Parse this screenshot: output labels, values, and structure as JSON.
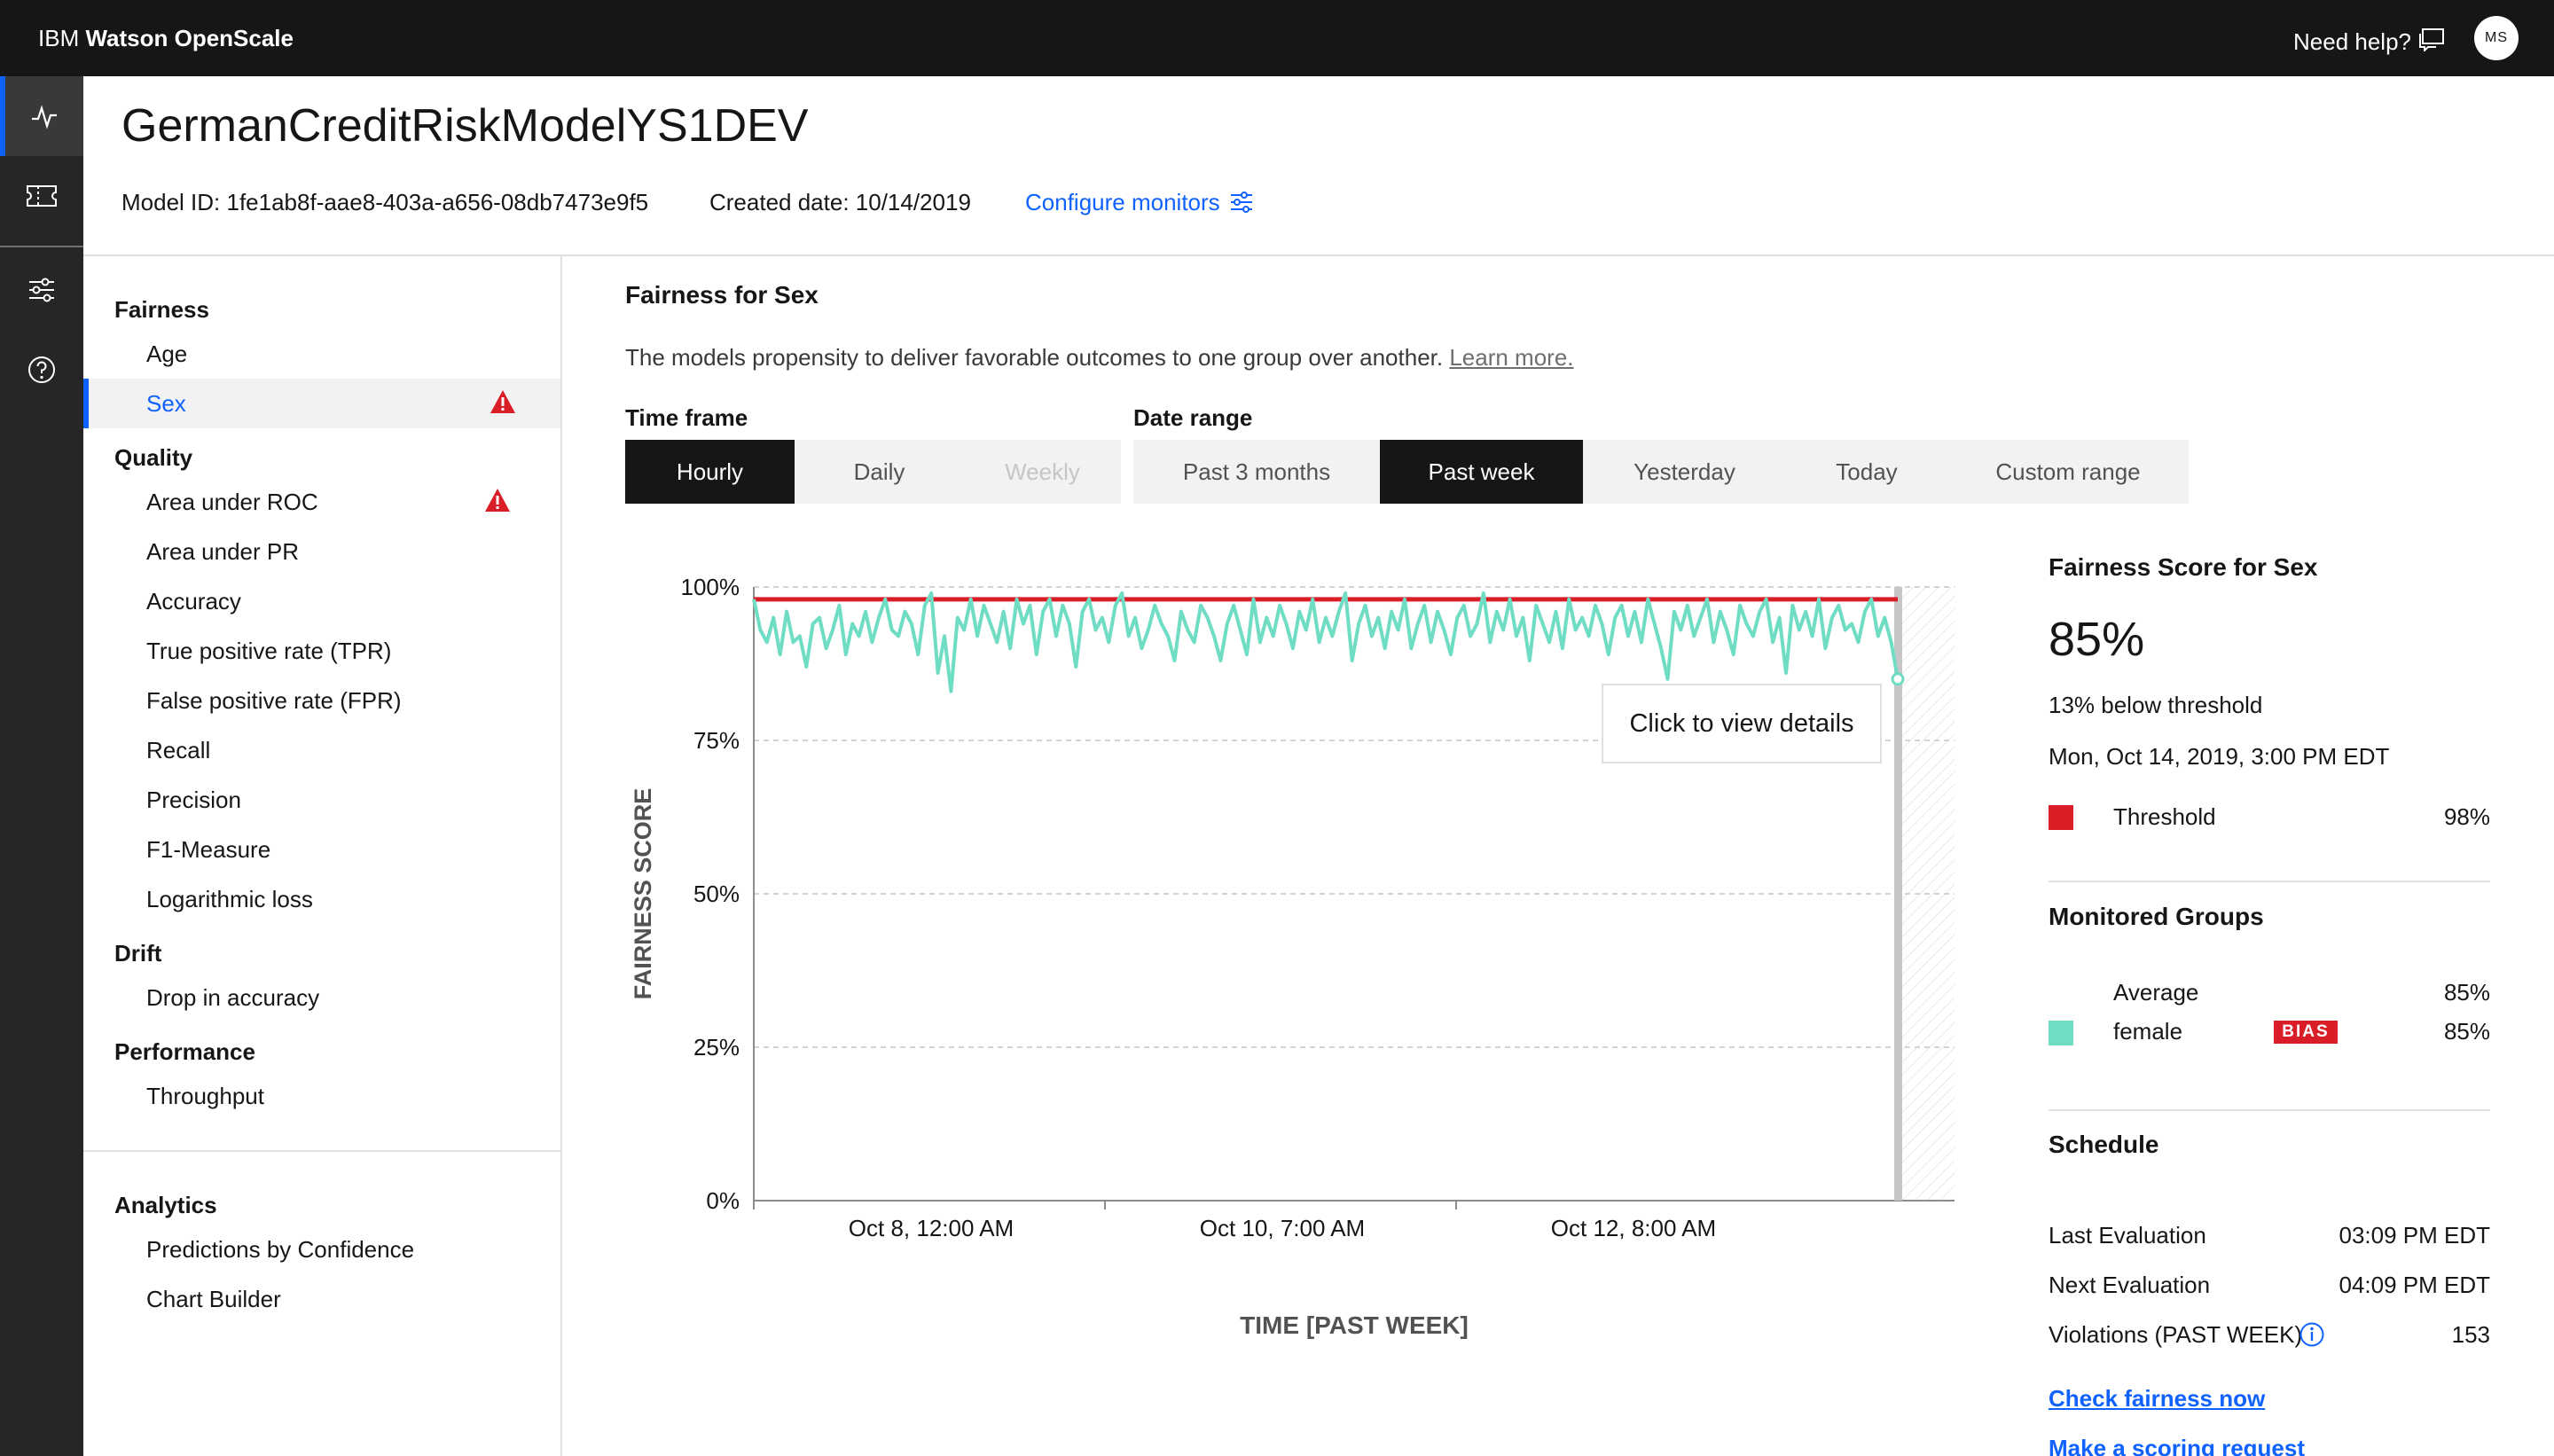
{
  "app": {
    "brand_prefix": "IBM ",
    "brand_name": "Watson OpenScale",
    "help_label": "Need help?",
    "user_initials": "MS"
  },
  "model": {
    "title": "GermanCreditRiskModelYS1DEV",
    "model_id": "Model ID: 1fe1ab8f-aae8-403a-a656-08db7473e9f5",
    "created": "Created date: 10/14/2019",
    "configure_label": "Configure monitors"
  },
  "nav": {
    "fairness": {
      "heading": "Fairness",
      "items": [
        "Age",
        "Sex"
      ]
    },
    "quality": {
      "heading": "Quality",
      "items": [
        "Area under ROC",
        "Area under PR",
        "Accuracy",
        "True positive rate (TPR)",
        "False positive rate (FPR)",
        "Recall",
        "Precision",
        "F1-Measure",
        "Logarithmic loss"
      ]
    },
    "drift": {
      "heading": "Drift",
      "items": [
        "Drop in accuracy"
      ]
    },
    "performance": {
      "heading": "Performance",
      "items": [
        "Throughput"
      ]
    },
    "analytics": {
      "heading": "Analytics",
      "items": [
        "Predictions by Confidence",
        "Chart Builder"
      ]
    },
    "selected": "Sex"
  },
  "main": {
    "section_title": "Fairness for Sex",
    "description": "The models propensity to deliver favorable outcomes to one group over another. ",
    "learn_more": "Learn more.",
    "timeframe_label": "Time frame",
    "timeframe_options": [
      "Hourly",
      "Daily",
      "Weekly"
    ],
    "timeframe_selected": "Hourly",
    "daterange_label": "Date range",
    "daterange_options": [
      "Past 3 months",
      "Past week",
      "Yesterday",
      "Today",
      "Custom range"
    ],
    "daterange_selected": "Past week",
    "tooltip": "Click to view details"
  },
  "chart_data": {
    "type": "line",
    "ylabel": "FAIRNESS SCORE",
    "xlabel": "TIME [PAST WEEK]",
    "ylim": [
      0,
      100
    ],
    "yticks": [
      "0%",
      "25%",
      "50%",
      "75%",
      "100%"
    ],
    "xticks": [
      "Oct 8, 12:00 AM",
      "Oct 10, 7:00 AM",
      "Oct 12, 8:00 AM"
    ],
    "threshold": 98,
    "threshold_color": "#da1e28",
    "series": [
      {
        "name": "female",
        "color": "#6fdcc4",
        "values": [
          98,
          93,
          91,
          95,
          89,
          96,
          91,
          92,
          87,
          94,
          95,
          90,
          93,
          97,
          89,
          94,
          92,
          96,
          91,
          95,
          98,
          93,
          92,
          96,
          94,
          89,
          97,
          99,
          86,
          92,
          83,
          95,
          93,
          98,
          92,
          97,
          94,
          91,
          96,
          90,
          98,
          94,
          97,
          89,
          96,
          98,
          92,
          97,
          94,
          87,
          96,
          98,
          93,
          95,
          91,
          97,
          99,
          92,
          95,
          90,
          93,
          97,
          94,
          92,
          88,
          96,
          93,
          91,
          97,
          95,
          92,
          88,
          94,
          97,
          93,
          89,
          98,
          91,
          95,
          92,
          97,
          94,
          90,
          96,
          93,
          98,
          91,
          95,
          92,
          96,
          99,
          88,
          94,
          97,
          92,
          95,
          90,
          96,
          93,
          98,
          90,
          94,
          97,
          91,
          96,
          93,
          89,
          95,
          97,
          92,
          94,
          99,
          91,
          96,
          93,
          98,
          92,
          95,
          88,
          97,
          94,
          91,
          96,
          90,
          98,
          93,
          95,
          92,
          97,
          94,
          89,
          95,
          97,
          92,
          96,
          91,
          98,
          94,
          90,
          85,
          96,
          93,
          97,
          92,
          95,
          98,
          91,
          96,
          93,
          89,
          97,
          94,
          92,
          96,
          98,
          91,
          95,
          86,
          97,
          93,
          96,
          92,
          98,
          90,
          95,
          97,
          93,
          94,
          91,
          96,
          98,
          92,
          95,
          91,
          85
        ]
      }
    ]
  },
  "panel": {
    "score_title": "Fairness Score for Sex",
    "score": "85%",
    "below": "13% below threshold",
    "timestamp": "Mon, Oct 14, 2019, 3:00 PM EDT",
    "threshold_label": "Threshold",
    "threshold_value": "98%",
    "groups_title": "Monitored Groups",
    "avg_label": "Average",
    "avg_value": "85%",
    "female_label": "female",
    "female_badge": "BIAS",
    "female_value": "85%",
    "schedule_title": "Schedule",
    "last_label": "Last Evaluation",
    "last_value": "03:09 PM EDT",
    "next_label": "Next Evaluation",
    "next_value": "04:09 PM EDT",
    "violations_label": "Violations (PAST WEEK)",
    "violations_value": "153",
    "check_link": "Check fairness now",
    "scoring_link": "Make a scoring request"
  },
  "colors": {
    "accent": "#0f62fe",
    "topbar": "#161616",
    "rail": "#262626",
    "threshold": "#da1e28",
    "series": "#6fdcc4",
    "bias": "#da1e28"
  }
}
